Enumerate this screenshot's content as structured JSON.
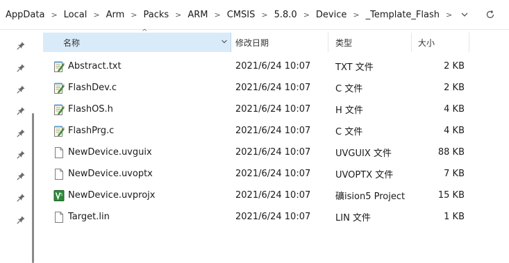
{
  "breadcrumb": [
    "AppData",
    "Local",
    "Arm",
    "Packs",
    "ARM",
    "CMSIS",
    "5.8.0",
    "Device",
    "_Template_Flash"
  ],
  "breadcrumb_separator": ">",
  "address_bar": {
    "dropdown_icon": "chevron-down-icon",
    "refresh_icon": "refresh-icon"
  },
  "columns": {
    "name": "名称",
    "modified": "修改日期",
    "type": "类型",
    "size": "大小",
    "sort_indicator": "^"
  },
  "files": [
    {
      "name": "Abstract.txt",
      "modified": "2021/6/24 10:07",
      "type": "TXT 文件",
      "size": "2 KB",
      "icon": "notepad-icon"
    },
    {
      "name": "FlashDev.c",
      "modified": "2021/6/24 10:07",
      "type": "C 文件",
      "size": "2 KB",
      "icon": "notepad-icon"
    },
    {
      "name": "FlashOS.h",
      "modified": "2021/6/24 10:07",
      "type": "H 文件",
      "size": "4 KB",
      "icon": "notepad-icon"
    },
    {
      "name": "FlashPrg.c",
      "modified": "2021/6/24 10:07",
      "type": "C 文件",
      "size": "4 KB",
      "icon": "notepad-icon"
    },
    {
      "name": "NewDevice.uvguix",
      "modified": "2021/6/24 10:07",
      "type": "UVGUIX 文件",
      "size": "88 KB",
      "icon": "blank-file-icon"
    },
    {
      "name": "NewDevice.uvoptx",
      "modified": "2021/6/24 10:07",
      "type": "UVOPTX 文件",
      "size": "7 KB",
      "icon": "blank-file-icon"
    },
    {
      "name": "NewDevice.uvprojx",
      "modified": "2021/6/24 10:07",
      "type": "礦ision5 Project",
      "size": "15 KB",
      "icon": "keil-project-icon"
    },
    {
      "name": "Target.lin",
      "modified": "2021/6/24 10:07",
      "type": "LIN 文件",
      "size": "1 KB",
      "icon": "blank-file-icon"
    }
  ],
  "colors": {
    "header_selected": "#d9ebf9",
    "keil_green": "#2e8b3a"
  }
}
